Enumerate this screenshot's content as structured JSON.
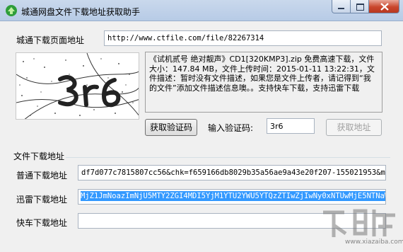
{
  "window": {
    "title": "城通网盘文件下载地址获取助手",
    "icon": "green-app-icon",
    "controls": [
      "minimize-icon",
      "maximize-icon",
      "close-icon"
    ]
  },
  "page_url": {
    "label": "城通下载页面地址",
    "value": "http://www.ctfile.com/file/82267314"
  },
  "captcha": {
    "image_text": "3r6"
  },
  "description": "《试机贰号 绝对靓声》CD1[320KMP3].zip 免费高速下载，文件大小：147.84 MB，文件上传时间：2015-01-11 13:22:31，文件描述：暂时没有文件描述，如果您是文件上传者，请记得到“我的文件”添加文件描述信息噢。。支持快车下载，支持迅雷下载",
  "actions": {
    "get_captcha": "获取验证码",
    "captcha_input_label": "输入验证码:",
    "captcha_input_value": "3r6",
    "get_address": "获取地址"
  },
  "download_section": {
    "title": "文件下载地址",
    "normal": {
      "label": "普通下载地址",
      "value": "df7d077c7815807cc56&chk=f659166db8029b35a56ae9a43e20f207-155021953&mtd=1"
    },
    "thunder": {
      "label": "迅雷下载地址",
      "value": "MjZ1JmNoazImNjU5MTY2ZGI4MDI5YjM1YTU2YWU5YTQzZTIwZjIwNy0xNTUwMjE5NTNaWg=="
    },
    "flashget": {
      "label": "快车下载地址",
      "value": ""
    }
  },
  "watermark": "www.xiazaiba.com"
}
